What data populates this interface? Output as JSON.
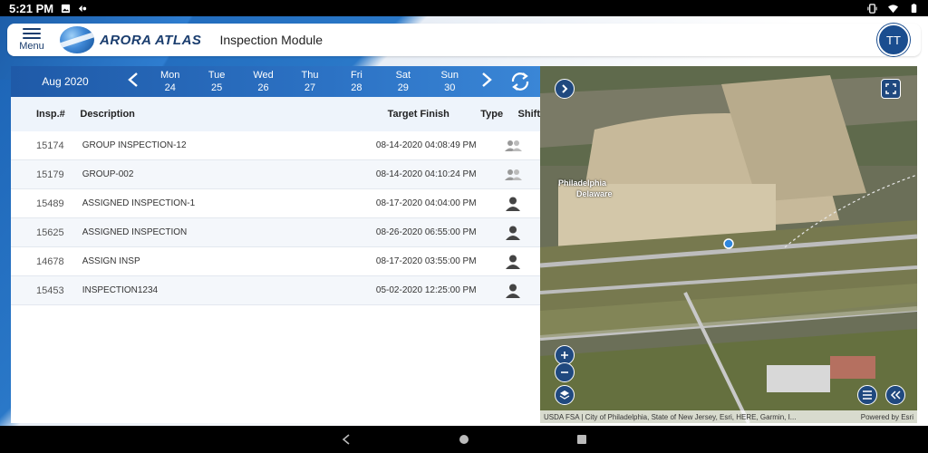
{
  "status_bar": {
    "time": "5:21 PM"
  },
  "header": {
    "menu_label": "Menu",
    "brand": "ARORA ATLAS",
    "module_title": "Inspection Module",
    "avatar_initials": "TT"
  },
  "calendar": {
    "month": "Aug 2020",
    "days": [
      {
        "name": "Mon",
        "date": "24"
      },
      {
        "name": "Tue",
        "date": "25"
      },
      {
        "name": "Wed",
        "date": "26"
      },
      {
        "name": "Thu",
        "date": "27"
      },
      {
        "name": "Fri",
        "date": "28"
      },
      {
        "name": "Sat",
        "date": "29"
      },
      {
        "name": "Sun",
        "date": "30"
      }
    ]
  },
  "table": {
    "headers": {
      "insp": "Insp.#",
      "description": "Description",
      "target": "Target Finish",
      "type": "Type",
      "shift": "Shift"
    },
    "rows": [
      {
        "insp": "15174",
        "description": "GROUP INSPECTION-12",
        "target": "08-14-2020 04:08:49 PM",
        "type": "group-icon"
      },
      {
        "insp": "15179",
        "description": "GROUP-002",
        "target": "08-14-2020 04:10:24 PM",
        "type": "group-icon"
      },
      {
        "insp": "15489",
        "description": "ASSIGNED INSPECTION-1",
        "target": "08-17-2020 04:04:00 PM",
        "type": "person-icon"
      },
      {
        "insp": "15625",
        "description": "ASSIGNED INSPECTION",
        "target": "08-26-2020 06:55:00 PM",
        "type": "person-icon"
      },
      {
        "insp": "14678",
        "description": "ASSIGN INSP",
        "target": "08-17-2020 03:55:00 PM",
        "type": "person-icon"
      },
      {
        "insp": "15453",
        "description": "INSPECTION1234",
        "target": "05-02-2020 12:25:00 PM",
        "type": "person-icon"
      }
    ]
  },
  "map": {
    "label_line1": "Philadelphia",
    "label_line2": "Delaware",
    "attribution": "USDA FSA | City of Philadelphia, State of New Jersey, Esri, HERE, Garmin, I...",
    "powered_by": "Powered by Esri"
  },
  "colors": {
    "brand_blue": "#1f5aa8",
    "header_navy": "#1a3d6e",
    "map_button": "#20497f"
  }
}
